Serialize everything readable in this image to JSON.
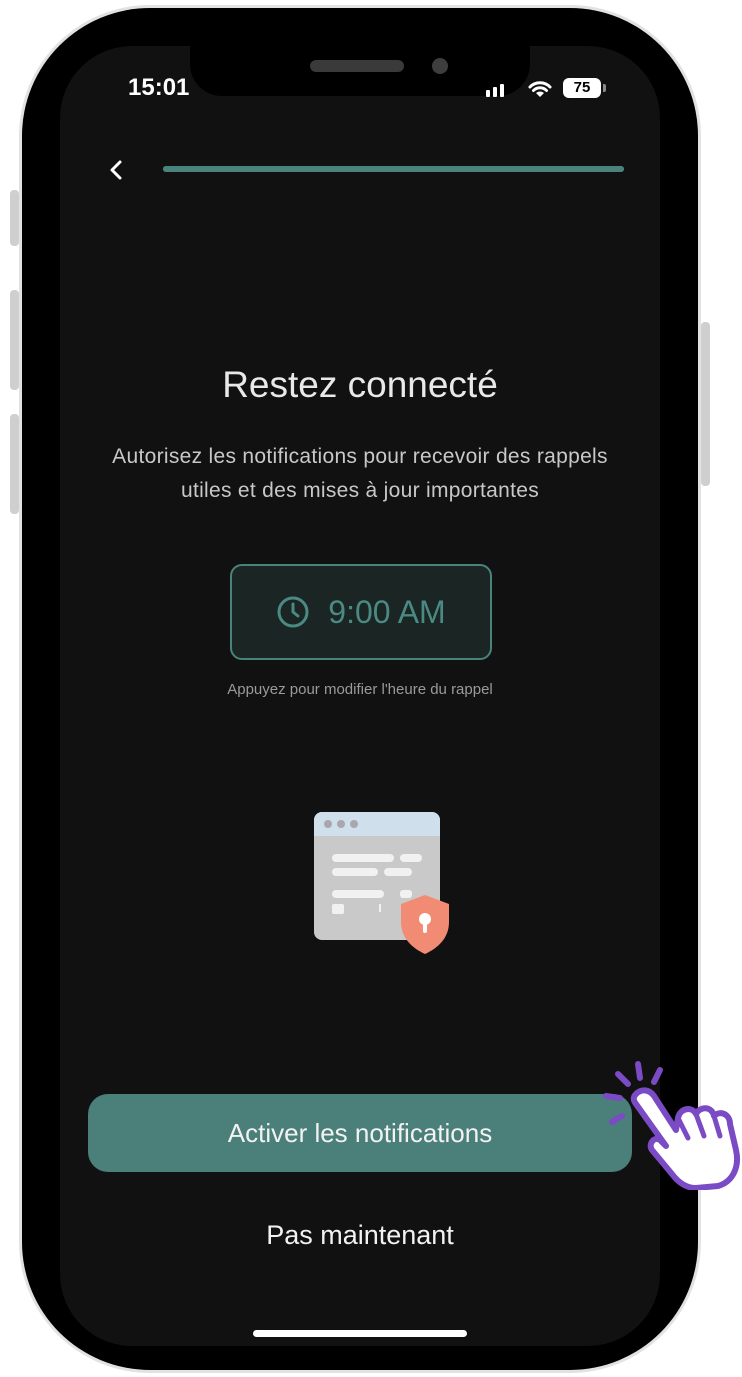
{
  "status_bar": {
    "time": "15:01",
    "battery": "75"
  },
  "onboarding": {
    "progress_percent": 100,
    "title": "Restez connecté",
    "subtitle": "Autorisez les notifications pour recevoir des rappels utiles et des mises à jour importantes",
    "reminder_time": "9:00 AM",
    "reminder_hint": "Appuyez pour modifier l'heure du rappel"
  },
  "actions": {
    "primary_label": "Activer les notifications",
    "secondary_label": "Pas maintenant"
  },
  "icons": {
    "back": "chevron-left-icon",
    "clock": "clock-icon",
    "illustration": "browser-shield-lock-icon",
    "tap_hint": "tap-hand-icon"
  },
  "colors": {
    "accent": "#4a7f7a",
    "background": "#111111",
    "shield": "#f28b74",
    "tap_hand": "#7b4bc6"
  }
}
